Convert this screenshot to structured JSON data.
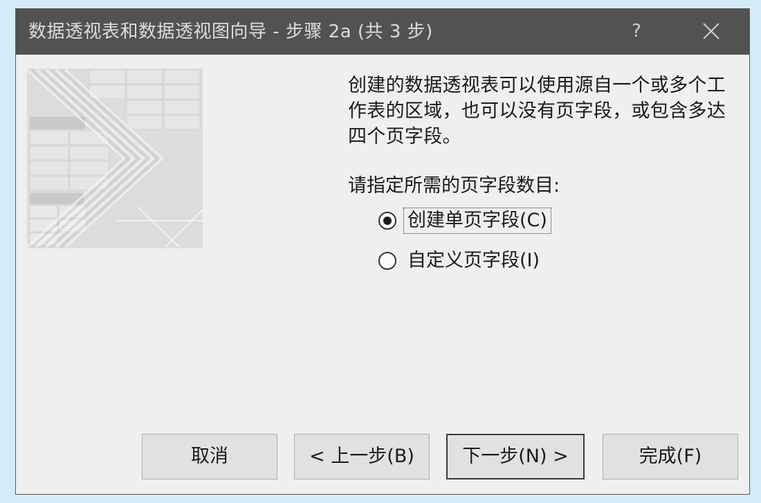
{
  "window": {
    "title": "数据透视表和数据透视图向导 - 步骤 2a (共 3 步)",
    "help_glyph": "?",
    "close_icon": "close-icon"
  },
  "content": {
    "description": "创建的数据透视表可以使用源自一个或多个工作表的区域，也可以没有页字段，或包含多达四个页字段。",
    "prompt": "请指定所需的页字段数目:",
    "options": [
      {
        "label": "创建单页字段(C)",
        "selected": true
      },
      {
        "label": "自定义页字段(I)",
        "selected": false
      }
    ]
  },
  "buttons": {
    "cancel": "取消",
    "back": "< 上一步(B)",
    "next": "下一步(N) >",
    "finish": "完成(F)"
  },
  "colors": {
    "titlebar": "#525252",
    "dialog_bg": "#efefef",
    "page_bg": "#d6ebf8"
  }
}
